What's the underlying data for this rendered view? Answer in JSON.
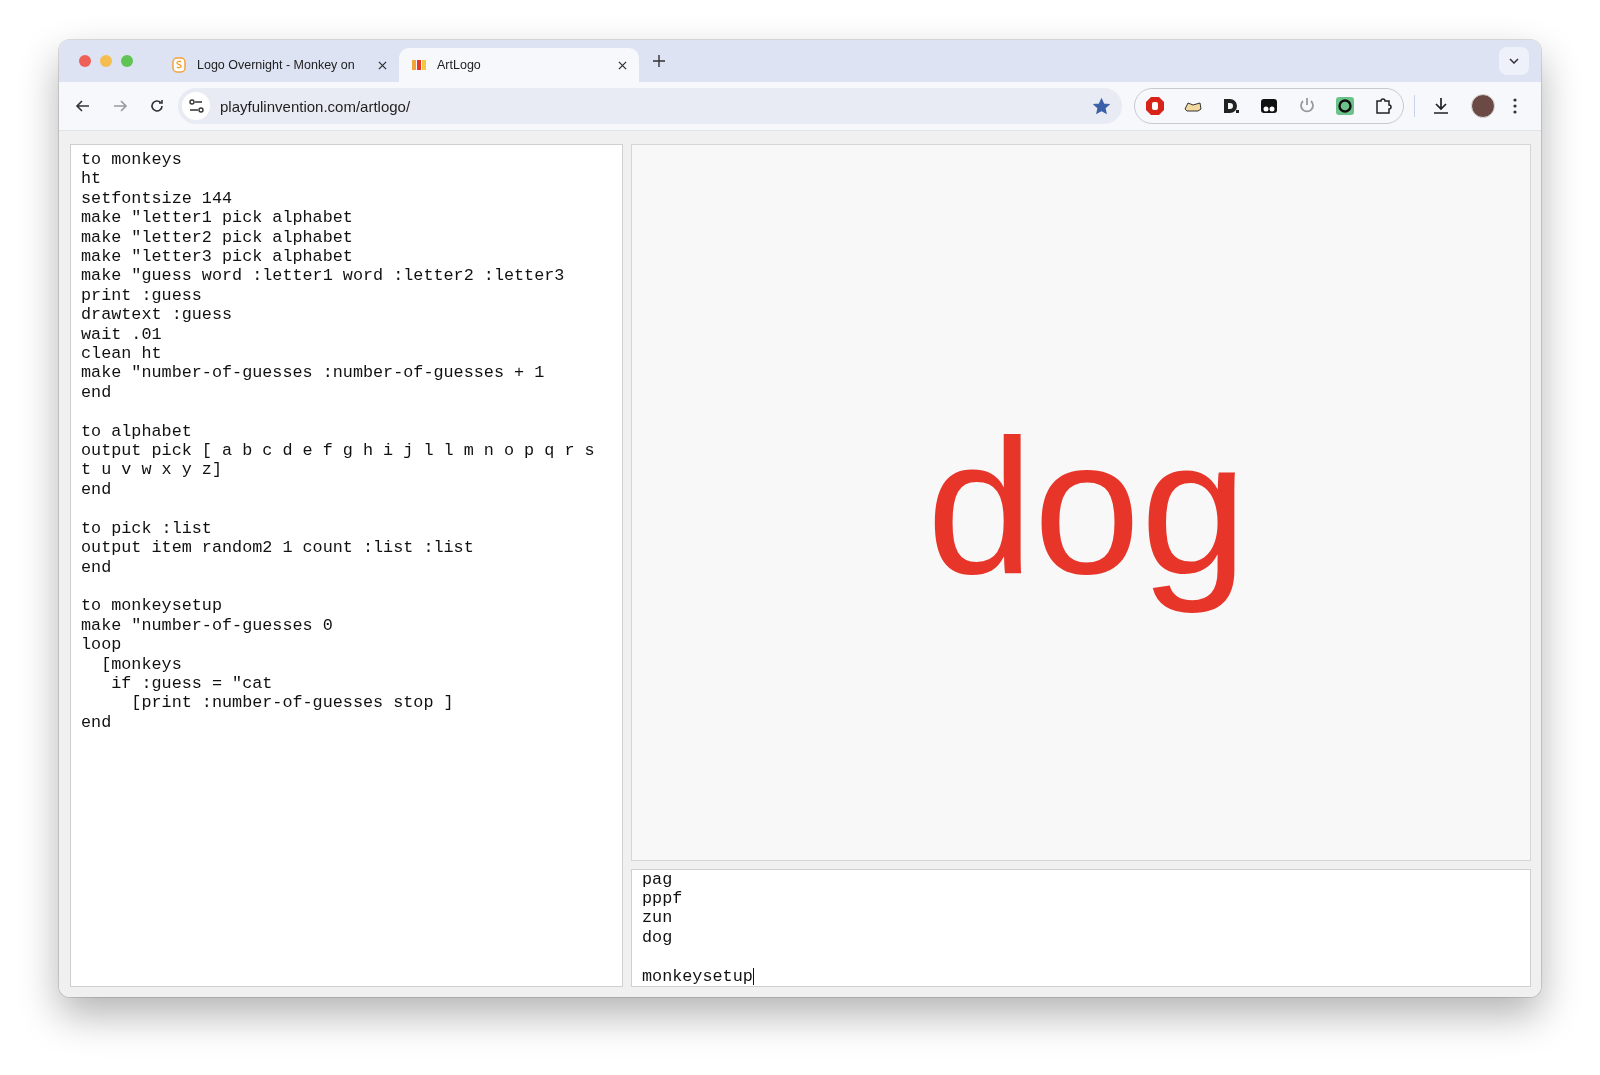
{
  "browser": {
    "tabs": [
      {
        "title": "Logo Overnight - Monkey on",
        "selected": false
      },
      {
        "title": "ArtLogo",
        "selected": true
      }
    ],
    "address": "playfulinvention.com/artlogo/",
    "bookmarked": true
  },
  "editor": {
    "blocks": [
      {
        "lines": [
          "to monkeys",
          "ht",
          "setfontsize 144",
          "make \"letter1 pick alphabet",
          "make \"letter2 pick alphabet",
          "make \"letter3 pick alphabet",
          "make \"guess word :letter1 word :letter2 :letter3",
          "print :guess",
          "drawtext :guess",
          "wait .01",
          "clean ht",
          "make \"number-of-guesses :number-of-guesses + 1",
          "end"
        ]
      },
      {
        "lines": [
          "to alphabet",
          "output pick [ a b c d e f g h i j l l m n o p q r s",
          "t u v w x y z]",
          "end"
        ]
      },
      {
        "lines": [
          "to pick :list",
          "output item random2 1 count :list :list",
          "end"
        ]
      },
      {
        "lines": [
          "to monkeysetup",
          "make \"number-of-guesses 0",
          "loop",
          "  [monkeys",
          "   if :guess = \"cat",
          "     [print :number-of-guesses stop ]",
          "end"
        ]
      }
    ]
  },
  "canvas": {
    "text": "dog"
  },
  "console": {
    "output": [
      "pag",
      "pppf",
      "zun",
      "dog"
    ],
    "input": "monkeysetup"
  }
}
